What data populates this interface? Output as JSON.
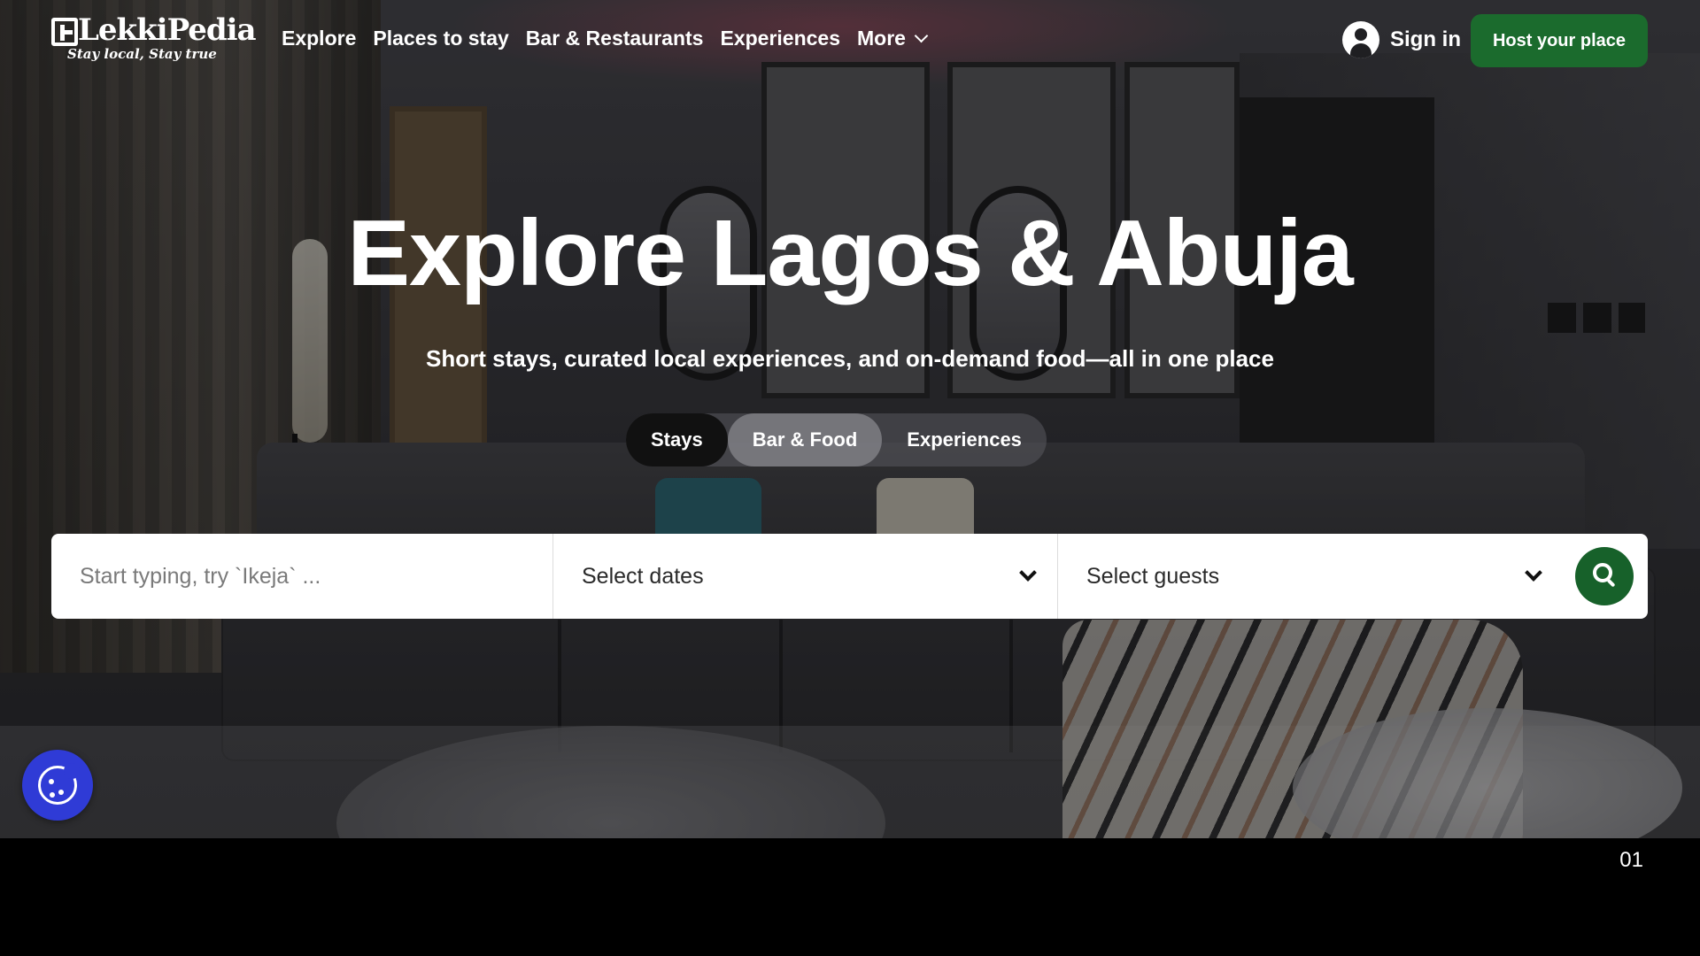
{
  "brand": {
    "name": "LekkiPedia",
    "tagline": "Stay local, Stay true"
  },
  "nav": {
    "items": [
      "Explore",
      "Places to stay",
      "Bar & Restaurants",
      "Experiences",
      "More"
    ]
  },
  "header": {
    "signin_label": "Sign in",
    "host_label": "Host your place"
  },
  "hero": {
    "title": "Explore Lagos & Abuja",
    "subtitle": "Short stays, curated local experiences, and on-demand food—all in one place"
  },
  "tabs": [
    {
      "label": "Stays",
      "active": true
    },
    {
      "label": "Bar & Food",
      "active": false
    },
    {
      "label": "Experiences",
      "active": false
    }
  ],
  "search": {
    "location_placeholder": "Start typing, try `Ikeja` ...",
    "dates_label": "Select dates",
    "guests_label": "Select guests"
  },
  "footer": {
    "page_number": "01"
  },
  "colors": {
    "primary_green": "#1b6b2d",
    "cookie_blue": "#2f3bd6"
  }
}
